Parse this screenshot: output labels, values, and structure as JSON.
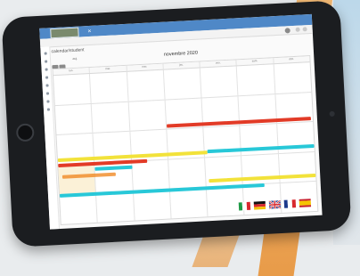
{
  "app": {
    "header_close": "×"
  },
  "page": {
    "title": "calendar/student",
    "crumb": ""
  },
  "calendar": {
    "month_label": "novembre 2020",
    "weekdays": [
      "lun.",
      "mar.",
      "mer.",
      "jeu.",
      "ven.",
      "sam.",
      "dim."
    ],
    "today_label": "auj."
  },
  "colors": {
    "header": "#4f88c7",
    "event_red": "#e23b27",
    "event_yellow": "#f2e23a",
    "event_cyan": "#28c8d8",
    "event_orange": "#f08a24"
  },
  "flags": [
    "italy-flag",
    "germany-flag",
    "uk-flag",
    "france-flag",
    "spain-flag"
  ]
}
